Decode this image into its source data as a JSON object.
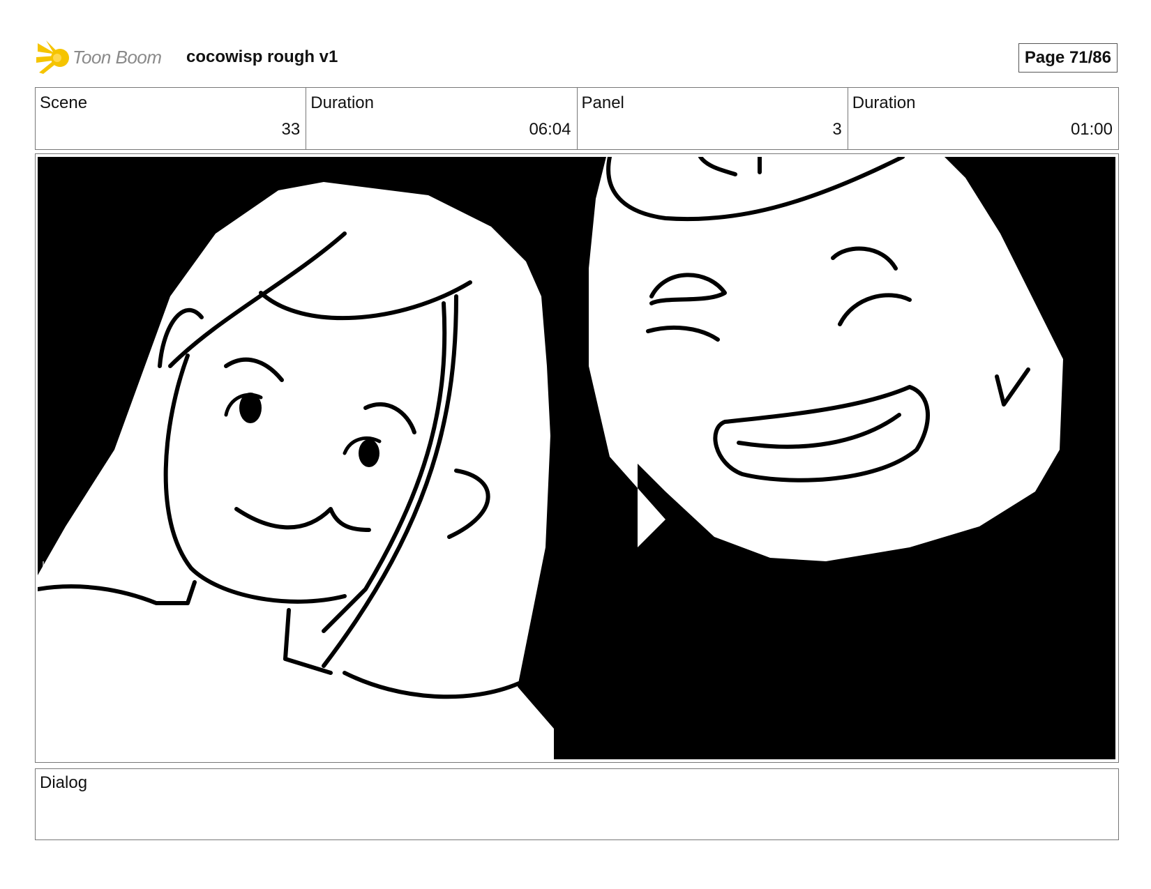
{
  "header": {
    "brand": "Toon Boom",
    "project_title": "cocowisp rough v1",
    "page_label": "Page 71/86"
  },
  "info": {
    "scene_label": "Scene",
    "scene_value": "33",
    "scene_duration_label": "Duration",
    "scene_duration_value": "06:04",
    "panel_label": "Panel",
    "panel_value": "3",
    "panel_duration_label": "Duration",
    "panel_duration_value": "01:00"
  },
  "dialog": {
    "label": "Dialog",
    "text": ""
  },
  "colors": {
    "logo_yellow": "#f5c400",
    "brand_gray": "#8a8a8a",
    "ink": "#000000"
  }
}
